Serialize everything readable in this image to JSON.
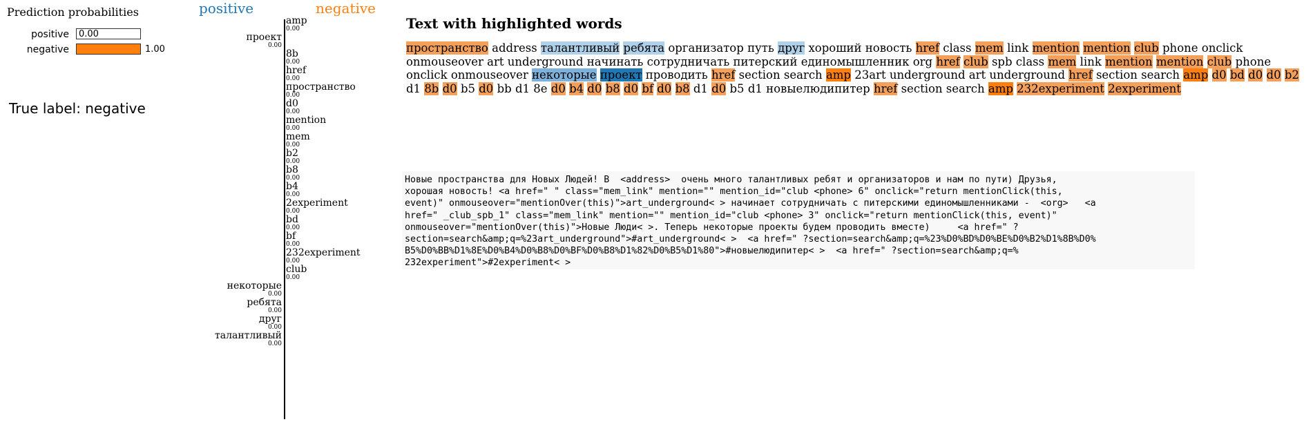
{
  "prediction": {
    "title": "Prediction probabilities",
    "rows": [
      {
        "label": "positive",
        "value_text": "0.00",
        "fraction": 0.0,
        "color": "#1f77b4"
      },
      {
        "label": "negative",
        "value_text": "1.00",
        "fraction": 1.0,
        "color": "#ff7f0e"
      }
    ]
  },
  "true_label": "True label: negative",
  "features": {
    "positive_header": "positive",
    "negative_header": "negative",
    "items": [
      {
        "name": "amp",
        "value": "0.00",
        "side": "negative"
      },
      {
        "name": "проект",
        "value": "0.00",
        "side": "positive"
      },
      {
        "name": "8b",
        "value": "0.00",
        "side": "negative"
      },
      {
        "name": "href",
        "value": "0.00",
        "side": "negative"
      },
      {
        "name": "пространство",
        "value": "0.00",
        "side": "negative"
      },
      {
        "name": "d0",
        "value": "0.00",
        "side": "negative"
      },
      {
        "name": "mention",
        "value": "0.00",
        "side": "negative"
      },
      {
        "name": "mem",
        "value": "0.00",
        "side": "negative"
      },
      {
        "name": "b2",
        "value": "0.00",
        "side": "negative"
      },
      {
        "name": "b8",
        "value": "0.00",
        "side": "negative"
      },
      {
        "name": "b4",
        "value": "0.00",
        "side": "negative"
      },
      {
        "name": "2experiment",
        "value": "0.00",
        "side": "negative"
      },
      {
        "name": "bd",
        "value": "0.00",
        "side": "negative"
      },
      {
        "name": "bf",
        "value": "0.00",
        "side": "negative"
      },
      {
        "name": "232experiment",
        "value": "0.00",
        "side": "negative"
      },
      {
        "name": "club",
        "value": "0.00",
        "side": "negative"
      },
      {
        "name": "некоторые",
        "value": "0.00",
        "side": "positive"
      },
      {
        "name": "ребята",
        "value": "0.00",
        "side": "positive"
      },
      {
        "name": "друг",
        "value": "0.00",
        "side": "positive"
      },
      {
        "name": "талантливый",
        "value": "0.00",
        "side": "positive"
      }
    ]
  },
  "highlight": {
    "title": "Text with highlighted words",
    "colors": {
      "neg": "#f5a05a",
      "neg_strong": "#ff7f0e",
      "pos_light": "#aed0e8",
      "pos": "#7fb2db",
      "pos_strong": "#1f77b4"
    },
    "tokens": [
      [
        "пространство",
        "neg"
      ],
      [
        "address",
        ""
      ],
      [
        "талантливый",
        "pos_light"
      ],
      [
        "ребята",
        "pos_light"
      ],
      [
        "организатор",
        ""
      ],
      [
        "путь",
        ""
      ],
      [
        "друг",
        "pos_light"
      ],
      [
        "хороший",
        ""
      ],
      [
        "новость",
        ""
      ],
      [
        "href",
        "neg"
      ],
      [
        "class",
        ""
      ],
      [
        "mem",
        "neg"
      ],
      [
        "link",
        ""
      ],
      [
        "mention",
        "neg"
      ],
      [
        "mention",
        "neg"
      ],
      [
        "club",
        "neg"
      ],
      [
        "phone",
        ""
      ],
      [
        "onclick",
        ""
      ],
      [
        "onmouseover",
        ""
      ],
      [
        "art",
        ""
      ],
      [
        "underground",
        ""
      ],
      [
        "начинать",
        ""
      ],
      [
        "сотрудничать",
        ""
      ],
      [
        "питерский",
        ""
      ],
      [
        "единомышленник",
        ""
      ],
      [
        "org",
        ""
      ],
      [
        "href",
        "neg"
      ],
      [
        "club",
        "neg"
      ],
      [
        "spb",
        ""
      ],
      [
        "class",
        ""
      ],
      [
        "mem",
        "neg"
      ],
      [
        "link",
        ""
      ],
      [
        "mention",
        "neg"
      ],
      [
        "mention",
        "neg"
      ],
      [
        "club",
        "neg"
      ],
      [
        "phone",
        ""
      ],
      [
        "onclick",
        ""
      ],
      [
        "onmouseover",
        ""
      ],
      [
        "некоторые",
        "pos"
      ],
      [
        "проект",
        "pos_strong"
      ],
      [
        "проводить",
        ""
      ],
      [
        "href",
        "neg"
      ],
      [
        "section",
        ""
      ],
      [
        "search",
        ""
      ],
      [
        "amp",
        "neg_strong"
      ],
      [
        "23art",
        ""
      ],
      [
        "underground",
        ""
      ],
      [
        "art",
        ""
      ],
      [
        "underground",
        ""
      ],
      [
        "href",
        "neg"
      ],
      [
        "section",
        ""
      ],
      [
        "search",
        ""
      ],
      [
        "amp",
        "neg_strong"
      ],
      [
        "d0",
        "neg"
      ],
      [
        "bd",
        "neg"
      ],
      [
        "d0",
        "neg"
      ],
      [
        "d0",
        "neg"
      ],
      [
        "b2",
        "neg"
      ],
      [
        "d1",
        ""
      ],
      [
        "8b",
        "neg"
      ],
      [
        "d0",
        "neg"
      ],
      [
        "b5",
        ""
      ],
      [
        "d0",
        "neg"
      ],
      [
        "bb",
        ""
      ],
      [
        "d1",
        ""
      ],
      [
        "8e",
        ""
      ],
      [
        "d0",
        "neg"
      ],
      [
        "b4",
        "neg"
      ],
      [
        "d0",
        "neg"
      ],
      [
        "b8",
        "neg"
      ],
      [
        "d0",
        "neg"
      ],
      [
        "bf",
        "neg"
      ],
      [
        "d0",
        "neg"
      ],
      [
        "b8",
        "neg"
      ],
      [
        "d1",
        ""
      ],
      [
        "d0",
        "neg"
      ],
      [
        "b5",
        ""
      ],
      [
        "d1",
        ""
      ],
      [
        "новыелюдипитер",
        ""
      ],
      [
        "href",
        "neg"
      ],
      [
        "section",
        ""
      ],
      [
        "search",
        ""
      ],
      [
        "amp",
        "neg_strong"
      ],
      [
        "232experiment",
        "neg"
      ],
      [
        "2experiment",
        "neg"
      ]
    ]
  },
  "raw_text": "Новые пространства для Новых Людей! В  <address>  очень много талантливых ребят и организаторов и нам по пути) Друзья,\nхорошая новость! <a href=\" \" class=\"mem_link\" mention=\"\" mention_id=\"club <phone> 6\" onclick=\"return mentionClick(this,\nevent)\" onmouseover=\"mentionOver(this)\">art_underground< > начинает сотрудничать с питерскими единомышленниками -  <org>   <a\nhref=\" _club_spb_1\" class=\"mem_link\" mention=\"\" mention_id=\"club <phone> 3\" onclick=\"return mentionClick(this, event)\"\nonmouseover=\"mentionOver(this)\">Новые Люди< >. Теперь некоторые проекты будем проводить вместе)     <a href=\" ?\nsection=search&amp;q=%23art_underground\">#art_underground< >  <a href=\" ?section=search&amp;q=%23%D0%BD%D0%BE%D0%B2%D1%8B%D0%\nB5%D0%BB%D1%8E%D0%B4%D0%B8%D0%BF%D0%B8%D1%82%D0%B5%D1%80\">#новыелюдипитер< >  <a href=\" ?section=search&amp;q=%\n232experiment\">#2experiment< >"
}
